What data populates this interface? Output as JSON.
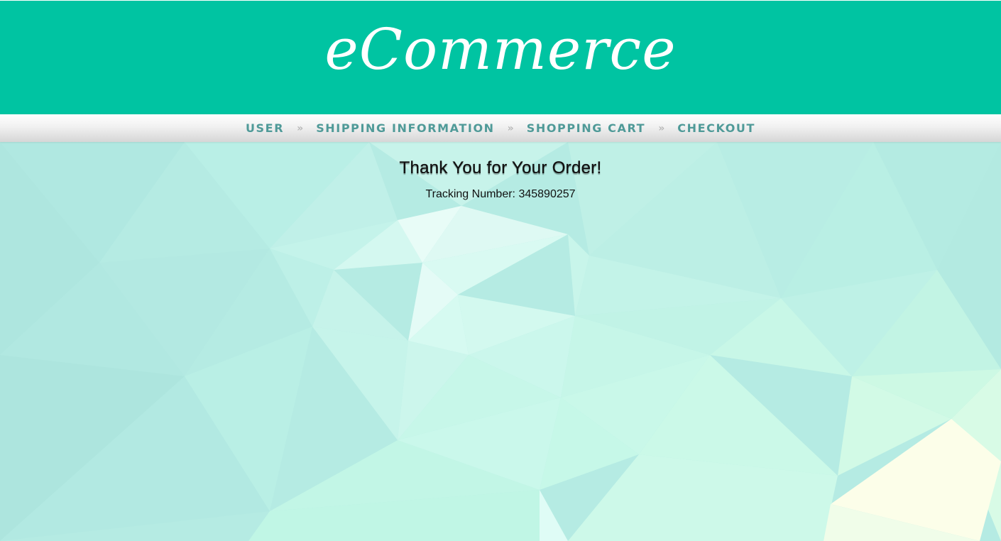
{
  "header": {
    "brand": "eCommerce"
  },
  "nav": {
    "steps": [
      "USER",
      "SHIPPING INFORMATION",
      "SHOPPING CART",
      "CHECKOUT"
    ],
    "separator": "»"
  },
  "main": {
    "heading": "Thank You for Your Order!",
    "tracking_label": "Tracking Number:",
    "tracking_number": "345890257"
  },
  "colors": {
    "header_bg": "#00c4a2",
    "nav_text": "#4f9a98",
    "page_bg": "#b7ebe3"
  }
}
